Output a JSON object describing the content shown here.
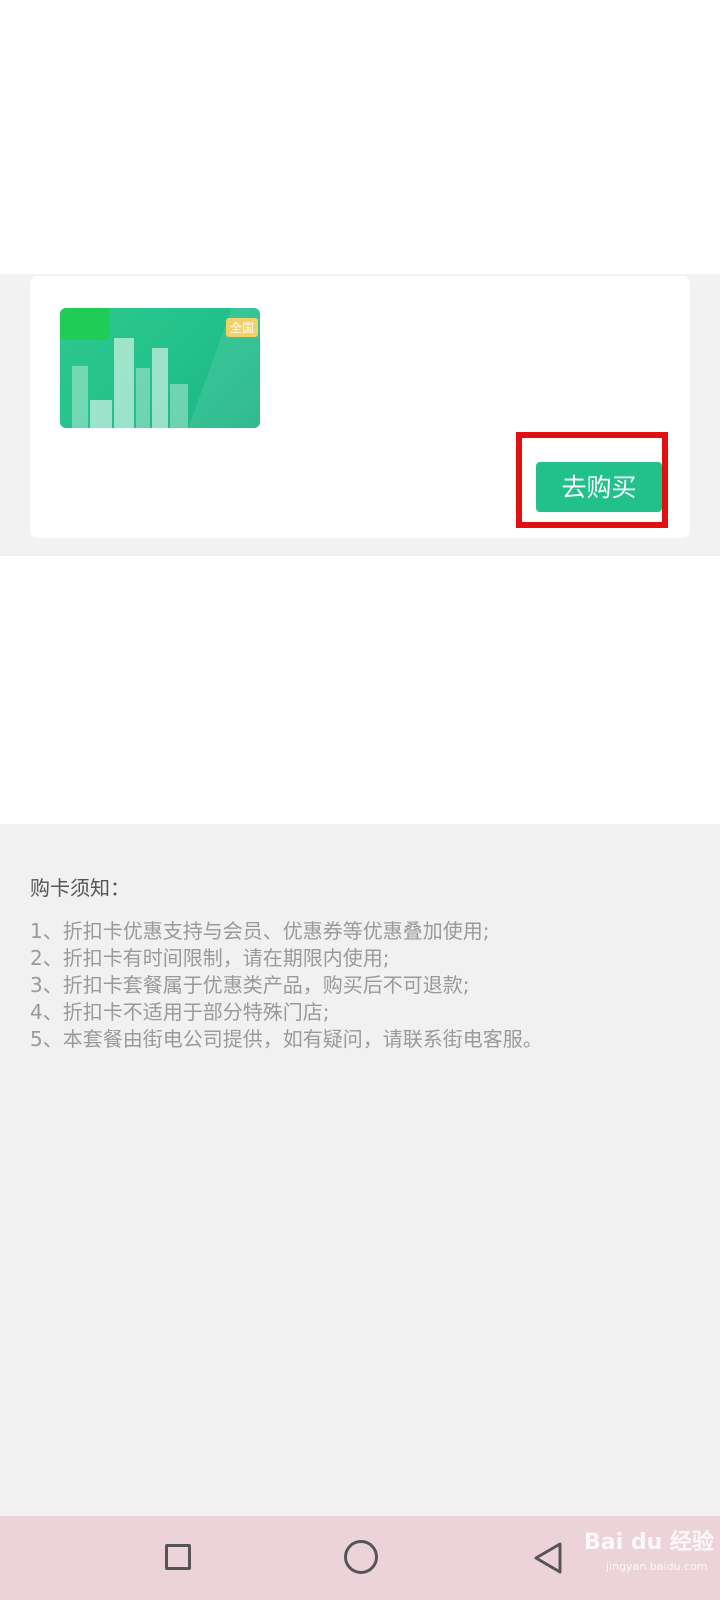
{
  "card": {
    "badge": "全国",
    "buy_button_label": "去购买"
  },
  "notice": {
    "title": "购卡须知：",
    "items": [
      "1、折扣卡优惠支持与会员、优惠券等优惠叠加使用;",
      "2、折扣卡有时间限制，请在期限内使用;",
      "3、折扣卡套餐属于优惠类产品，购买后不可退款;",
      "4、折扣卡不适用于部分特殊门店;",
      "5、本套餐由街电公司提供，如有疑问，请联系街电客服。"
    ]
  },
  "watermark": {
    "main": "Bai du 经验",
    "sub": "jingyan.baidu.com"
  },
  "colors": {
    "accent": "#22c08b",
    "highlight": "#e01010",
    "navbar": "#ecd3da"
  },
  "icons": {
    "nav_recents": "square-icon",
    "nav_home": "circle-icon",
    "nav_back": "back-triangle-icon"
  }
}
